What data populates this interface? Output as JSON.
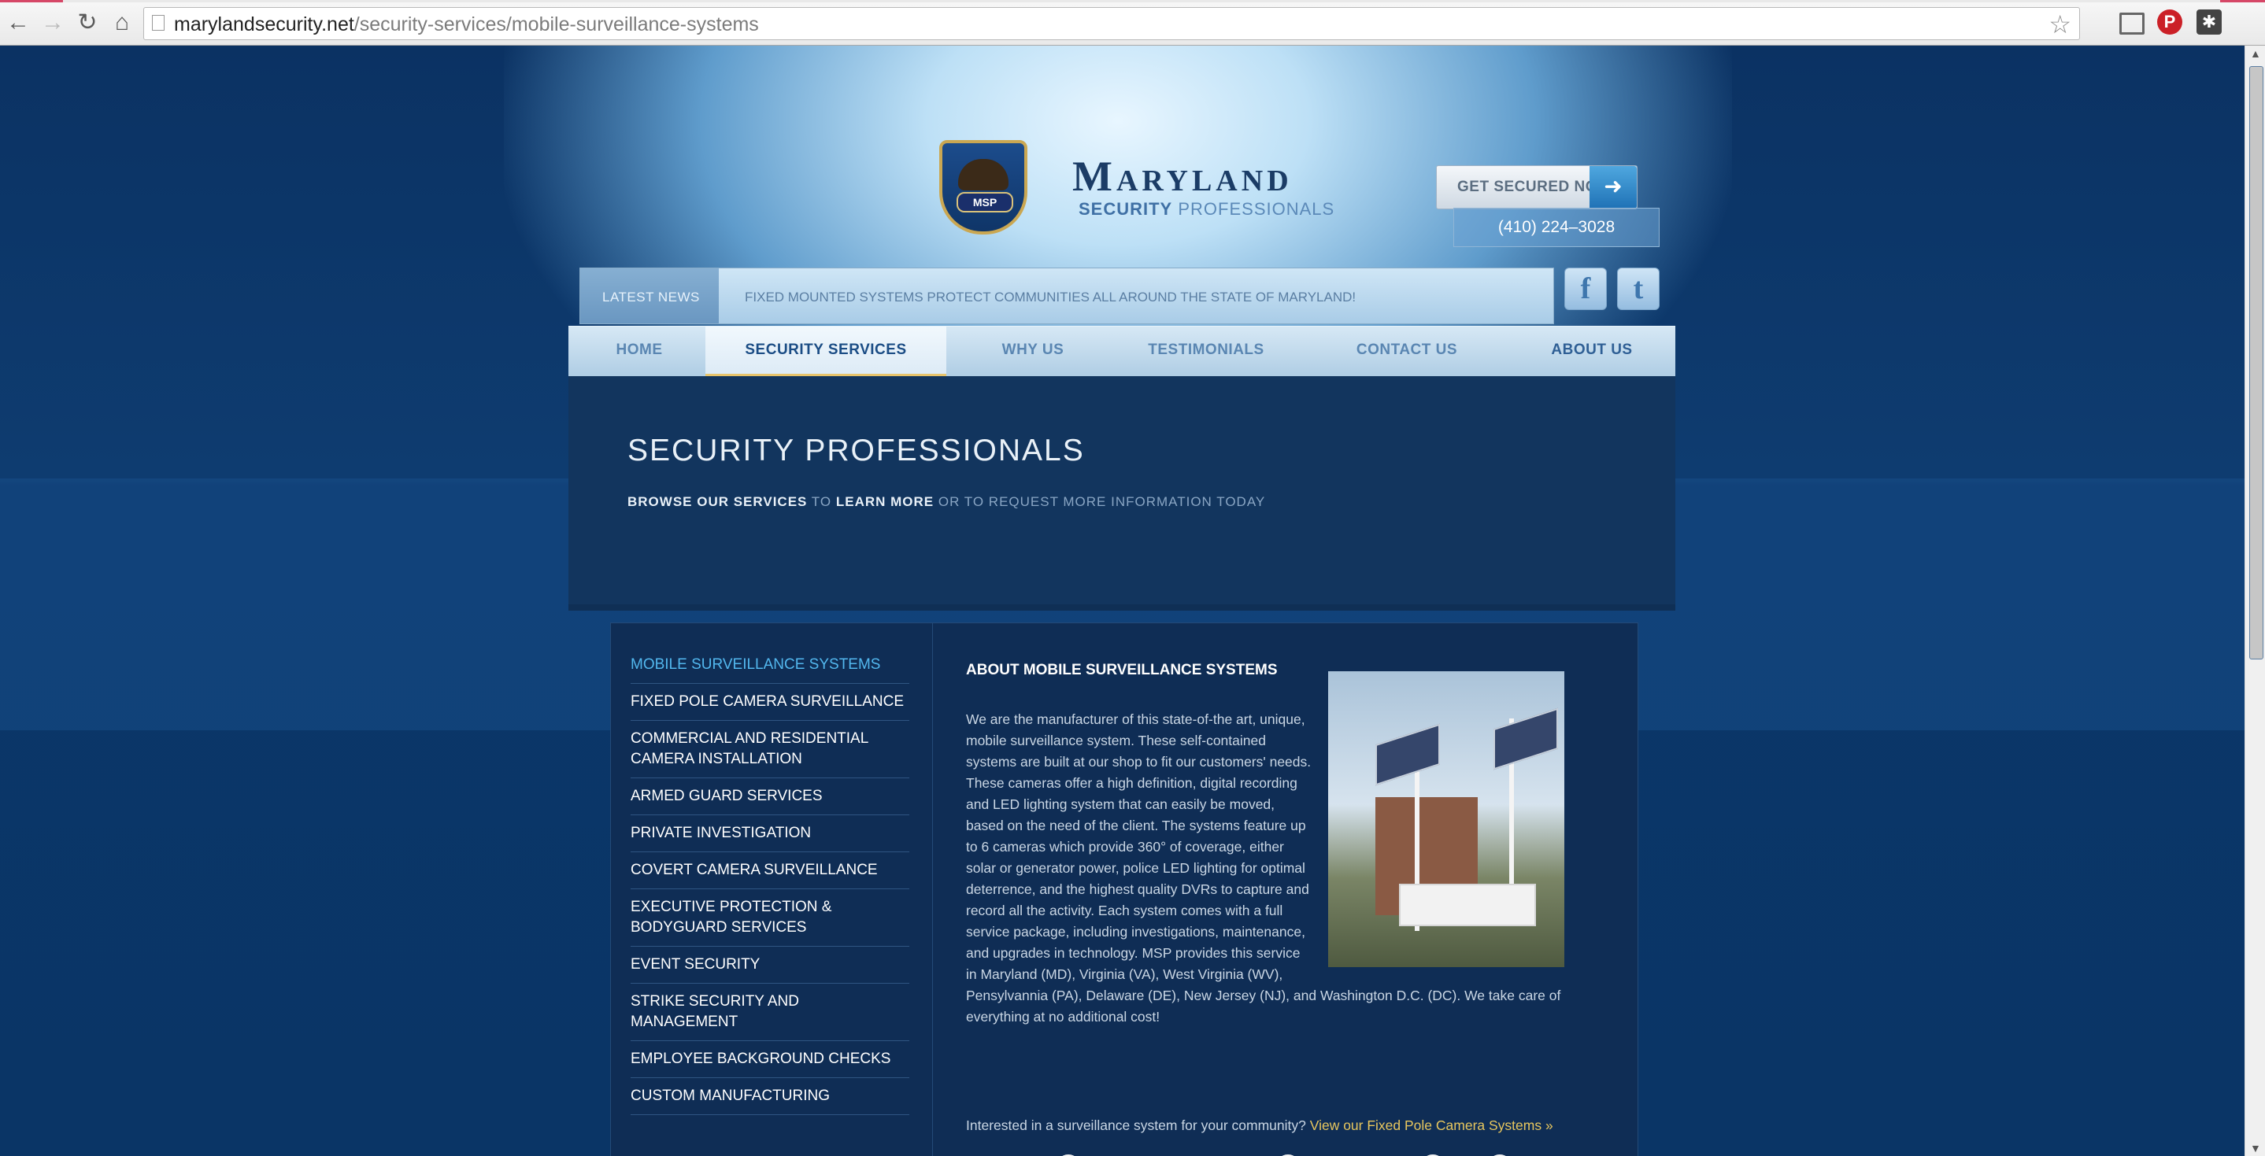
{
  "browser": {
    "url_domain": "marylandsecurity.net",
    "url_path": "/security-services/mobile-surveillance-systems"
  },
  "header": {
    "brand_name": "Maryland",
    "brand_sub_bold": "SECURITY",
    "brand_sub_rest": " PROFESSIONALS",
    "badge_text": "MSP",
    "cta_label": "GET SECURED NOW",
    "phone": "(410) 224–3028"
  },
  "news": {
    "tag": "LATEST NEWS",
    "message": "FIXED MOUNTED SYSTEMS PROTECT COMMUNITIES ALL AROUND THE STATE OF MARYLAND!"
  },
  "social": {
    "facebook": "f",
    "twitter": "t"
  },
  "nav": {
    "home": "HOME",
    "security_services": "SECURITY SERVICES",
    "why_us": "WHY US",
    "testimonials": "TESTIMONIALS",
    "contact_us": "CONTACT US",
    "about_us": "ABOUT US"
  },
  "hero": {
    "title": "SECURITY PROFESSIONALS",
    "sub_1": "BROWSE OUR SERVICES",
    "sub_2": " TO ",
    "sub_3": "LEARN MORE",
    "sub_4": " OR TO REQUEST MORE INFORMATION TODAY"
  },
  "sidebar": {
    "items": [
      "MOBILE SURVEILLANCE SYSTEMS",
      "FIXED POLE CAMERA SURVEILLANCE",
      "COMMERCIAL AND RESIDENTIAL CAMERA INSTALLATION",
      "ARMED GUARD SERVICES",
      "PRIVATE INVESTIGATION",
      "COVERT CAMERA SURVEILLANCE",
      "EXECUTIVE PROTECTION & BODYGUARD SERVICES",
      "EVENT SECURITY",
      "STRIKE SECURITY AND MANAGEMENT",
      "EMPLOYEE BACKGROUND CHECKS",
      "CUSTOM MANUFACTURING"
    ]
  },
  "main": {
    "title": "ABOUT MOBILE SURVEILLANCE SYSTEMS",
    "body": "We are the manufacturer of this state-of-the art, unique, mobile surveillance system. These self-contained systems are built at our shop to fit our customers' needs. These cameras offer a high definition, digital recording and LED lighting system that can easily be moved, based on the need of the client. The systems feature up to 6 cameras which provide 360° of coverage, either solar or generator power, police LED lighting for optimal deterrence, and the highest quality DVRs to capture and record all the activity. Each system comes with a full service package, including investigations, maintenance, and upgrades in technology. MSP provides this service in Maryland (MD), Virginia (VA), West Virginia (WV), Pensylvannia (PA), Delaware (DE), New Jersey (NJ), and Washington D.C. (DC).  We take care of everything at no additional cost!",
    "interest_text": "Interested in a surveillance system for your community? ",
    "interest_link": "View our Fixed Pole Camera Systems »"
  },
  "colors": {
    "page_bg": "#0c3766",
    "accent_link": "#52b7ee",
    "gold_link": "#e7c65e",
    "nav_active_underline": "#e7c46b"
  },
  "icons": [
    "back-arrow-icon",
    "forward-arrow-icon",
    "reload-icon",
    "home-icon",
    "star-icon",
    "cast-icon",
    "pinterest-icon",
    "extension-icon",
    "arrow-right-icon",
    "magnifier-icon"
  ]
}
